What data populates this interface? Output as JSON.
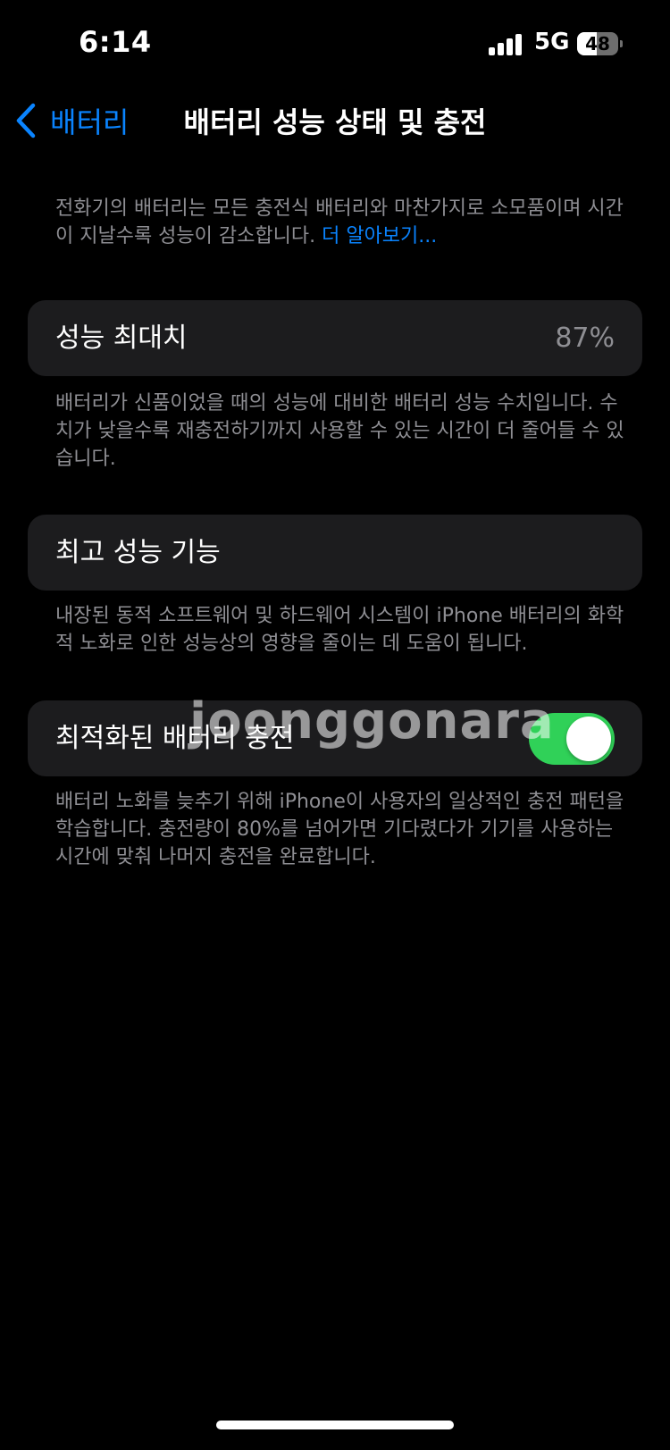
{
  "status_bar": {
    "time": "6:14",
    "network": "5G",
    "battery_level": "48",
    "battery_fraction": 0.48
  },
  "nav": {
    "back_label": "배터리",
    "back_icon": "chevron-left-icon",
    "title": "배터리 성능 상태 및 충전"
  },
  "intro": {
    "text": "전화기의 배터리는 모든 충전식 배터리와 마찬가지로 소모품이며 시간이 지날수록 성능이 감소합니다. ",
    "link": "더 알아보기..."
  },
  "max_capacity": {
    "label": "성능 최대치",
    "value": "87%",
    "description": "배터리가 신품이었을 때의 성능에 대비한 배터리 성능 수치입니다. 수치가 낮을수록 재충전하기까지 사용할 수 있는 시간이 더 줄어들 수 있습니다."
  },
  "peak_performance": {
    "label": "최고 성능 기능",
    "description": "내장된 동적 소프트웨어 및 하드웨어 시스템이 iPhone 배터리의 화학적 노화로 인한 성능상의 영향을 줄이는 데 도움이 됩니다."
  },
  "optimized_charging": {
    "label": "최적화된 배터리 충전",
    "enabled": true,
    "description": "배터리 노화를 늦추기 위해 iPhone이 사용자의 일상적인 충전 패턴을 학습합니다. 충전량이 80%를 넘어가면 기다렸다가 기기를 사용하는 시간에 맞춰 나머지 충전을 완료합니다."
  },
  "watermark": "joonggonara",
  "colors": {
    "accent": "#0a84ff",
    "toggle_on": "#30d158",
    "card_bg": "#1c1c1e",
    "secondary_text": "#8e8e93"
  }
}
